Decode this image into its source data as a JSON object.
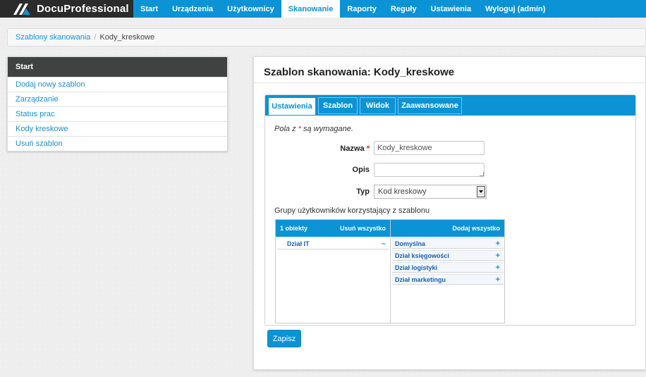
{
  "app": {
    "brand": "DocuProfessional"
  },
  "nav": {
    "items": [
      {
        "label": "Start",
        "active": false
      },
      {
        "label": "Urządzenia",
        "active": false
      },
      {
        "label": "Użytkownicy",
        "active": false
      },
      {
        "label": "Skanowanie",
        "active": true
      },
      {
        "label": "Raporty",
        "active": false
      },
      {
        "label": "Reguły",
        "active": false
      },
      {
        "label": "Ustawienia",
        "active": false
      },
      {
        "label": "Wyloguj (admin)",
        "active": false
      }
    ]
  },
  "breadcrumb": {
    "link": "Szablony skanowania",
    "separator": "/",
    "current": "Kody_kreskowe"
  },
  "sidebar": {
    "header": "Start",
    "items": [
      {
        "label": "Dodaj nowy szablon"
      },
      {
        "label": "Zarządzanie"
      },
      {
        "label": "Status prac"
      },
      {
        "label": "Kody kreskowe"
      },
      {
        "label": "Usuń szablon"
      }
    ]
  },
  "main": {
    "title": "Szablon skanowania: Kody_kreskowe",
    "tabs": [
      {
        "label": "Ustawienia",
        "active": true
      },
      {
        "label": "Szablon",
        "active": false
      },
      {
        "label": "Widok",
        "active": false
      },
      {
        "label": "Zaawansowane",
        "active": false
      }
    ],
    "required_note": {
      "prefix": "Pola z",
      "star": "*",
      "suffix": "są wymagane."
    },
    "form": {
      "name_label": "Nazwa",
      "name_star": "*",
      "name_value": "Kody_kreskowe",
      "desc_label": "Opis",
      "desc_value": "",
      "type_label": "Typ",
      "type_value": "Kod kreskowy"
    },
    "groups": {
      "label": "Grupy użytkowników korzystający z szablonu",
      "left_header": "1 obiekty",
      "remove_all": "Usuń wszystko",
      "add_all": "Dodaj wszystko",
      "selected": [
        {
          "label": "Dział IT",
          "op": "–"
        }
      ],
      "available": [
        {
          "label": "Domyślna",
          "op": "+"
        },
        {
          "label": "Dział księgowości",
          "op": "+"
        },
        {
          "label": "Dział logistyki",
          "op": "+"
        },
        {
          "label": "Dział marketingu",
          "op": "+"
        }
      ]
    },
    "save_label": "Zapisz"
  },
  "colors": {
    "accent": "#0b93d6",
    "brand_bg": "#2b2b2b",
    "sidebar_header": "#3f4240"
  }
}
